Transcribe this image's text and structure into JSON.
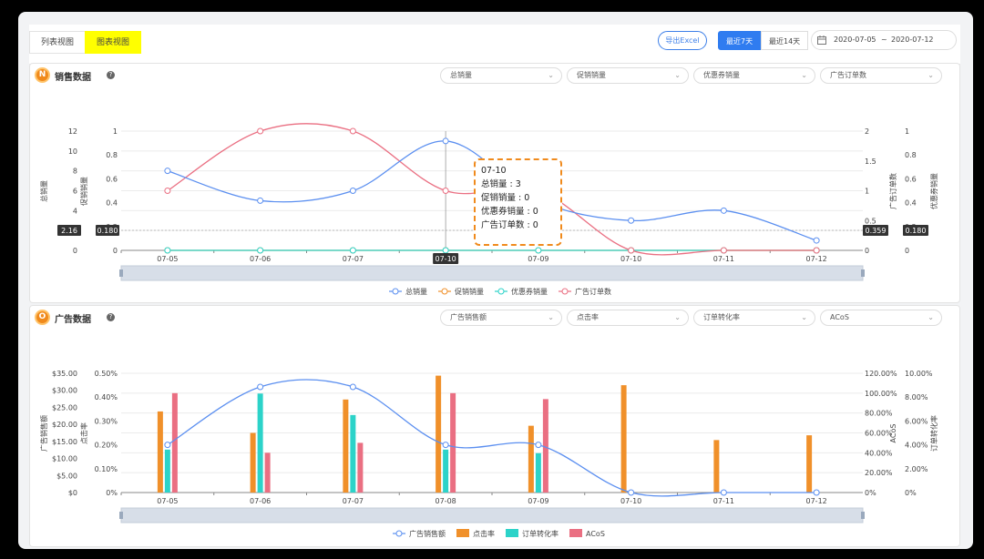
{
  "tabs": [
    {
      "label": "列表视图",
      "active": false
    },
    {
      "label": "图表视图",
      "active": true
    }
  ],
  "toolbar": {
    "export_label": "导出Excel",
    "range_7": "最近7天",
    "range_14": "最近14天",
    "date_start": "2020-07-05",
    "date_sep": "~",
    "date_end": "2020-07-12"
  },
  "sales": {
    "badge": "N",
    "title": "销售数据",
    "help": "?",
    "selects": [
      "总销量",
      "促销销量",
      "优惠券销量",
      "广告订单数"
    ],
    "tooltip": {
      "title": "07-10",
      "lines": [
        "总销量 : 3",
        "促销销量 : 0",
        "优惠券销量 : 0",
        "广告订单数 : 0"
      ]
    },
    "marker_left1": "2.16",
    "marker_left2": "0.180",
    "marker_right1": "0.359",
    "marker_right2": "0.180",
    "marker_x": "07-10"
  },
  "ads": {
    "badge": "O",
    "title": "广告数据",
    "help": "?",
    "selects": [
      "广告销售额",
      "点击率",
      "订单转化率",
      "ACoS"
    ]
  },
  "colors": {
    "blue": "#5b8ff0",
    "orange": "#f0902a",
    "teal": "#2cd3c9",
    "pink": "#ea6f82",
    "accent": "#2f7cf0"
  },
  "chart_data": [
    {
      "type": "line",
      "categories": [
        "07-05",
        "07-06",
        "07-07",
        "07-08",
        "07-09",
        "07-10",
        "07-11",
        "07-12"
      ],
      "series": [
        {
          "name": "总销量",
          "axis": "y1",
          "values": [
            8,
            5,
            6,
            11,
            5,
            3,
            4,
            1
          ]
        },
        {
          "name": "促销销量",
          "axis": "y2",
          "values": [
            0,
            0,
            0,
            0,
            0,
            0,
            0,
            0
          ]
        },
        {
          "name": "优惠券销量",
          "axis": "y4",
          "values": [
            0,
            0,
            0,
            0,
            0,
            0,
            0,
            0
          ]
        },
        {
          "name": "广告订单数",
          "axis": "y3",
          "values": [
            1,
            2,
            2,
            1,
            1,
            0,
            0,
            0
          ]
        }
      ],
      "axes": {
        "y1": {
          "label": "总销量",
          "ticks": [
            "0",
            "2",
            "4",
            "6",
            "8",
            "10",
            "12"
          ],
          "range": [
            0,
            12
          ]
        },
        "y2": {
          "label": "促销销量",
          "ticks": [
            "0",
            "0.2",
            "0.4",
            "0.6",
            "0.8",
            "1"
          ],
          "range": [
            0,
            1
          ]
        },
        "y3": {
          "label": "广告订单数",
          "ticks": [
            "0",
            "0.5",
            "1",
            "1.5",
            "2"
          ],
          "range": [
            0,
            2
          ]
        },
        "y4": {
          "label": "优惠券销量",
          "ticks": [
            "0",
            "0.2",
            "0.4",
            "0.6",
            "0.8",
            "1"
          ],
          "range": [
            0,
            1
          ]
        }
      }
    },
    {
      "type": "bar",
      "categories": [
        "07-05",
        "07-06",
        "07-07",
        "07-08",
        "07-09",
        "07-10",
        "07-11",
        "07-12"
      ],
      "series": [
        {
          "name": "广告销售额",
          "kind": "line",
          "axis": "y1",
          "values": [
            14,
            31,
            31,
            14,
            14,
            0,
            0,
            0
          ]
        },
        {
          "name": "点击率",
          "kind": "bar",
          "axis": "y2",
          "values": [
            0.34,
            0.25,
            0.39,
            0.49,
            0.28,
            0.45,
            0.22,
            0.24
          ]
        },
        {
          "name": "订单转化率",
          "kind": "bar",
          "axis": "y4",
          "values": [
            3.6,
            8.3,
            6.5,
            3.6,
            3.3,
            0,
            0,
            0
          ]
        },
        {
          "name": "ACoS",
          "kind": "bar",
          "axis": "y3",
          "values": [
            100,
            40,
            50,
            100,
            94,
            0,
            0,
            0
          ]
        }
      ],
      "axes": {
        "y1": {
          "label": "广告销售额",
          "ticks": [
            "$0",
            "$5.00",
            "$10.00",
            "$15.00",
            "$20.00",
            "$25.00",
            "$30.00",
            "$35.00"
          ],
          "range": [
            0,
            35
          ]
        },
        "y2": {
          "label": "点击率",
          "ticks": [
            "0%",
            "0.10%",
            "0.20%",
            "0.30%",
            "0.40%",
            "0.50%"
          ],
          "range": [
            0,
            0.5
          ]
        },
        "y3": {
          "label": "ACoS",
          "ticks": [
            "0%",
            "20.00%",
            "40.00%",
            "60.00%",
            "80.00%",
            "100.00%",
            "120.00%"
          ],
          "range": [
            0,
            120
          ]
        },
        "y4": {
          "label": "订单转化率",
          "ticks": [
            "0%",
            "2.00%",
            "4.00%",
            "6.00%",
            "8.00%",
            "10.00%"
          ],
          "range": [
            0,
            10
          ]
        }
      }
    }
  ]
}
